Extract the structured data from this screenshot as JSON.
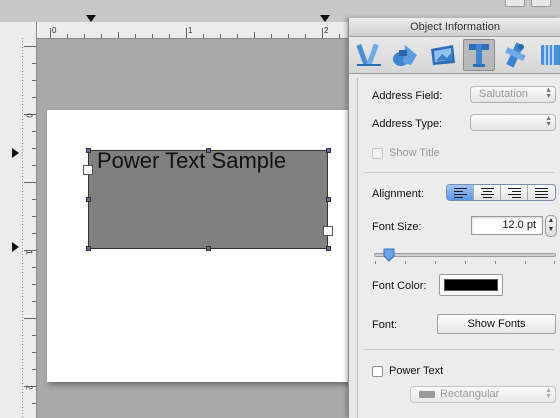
{
  "rulers": {
    "horizontal_numbers": [
      "0",
      "1",
      "2"
    ],
    "vertical_numbers": [
      "0",
      "1",
      "2"
    ]
  },
  "canvas": {
    "text_box_text": "Power Text Sample",
    "text_box_fill": "#808080"
  },
  "inspector": {
    "title": "Object Information",
    "toolbar": [
      {
        "name": "arrange-icon",
        "selected": false
      },
      {
        "name": "graphic-icon",
        "selected": false
      },
      {
        "name": "image-icon",
        "selected": false
      },
      {
        "name": "text-icon",
        "selected": true
      },
      {
        "name": "database-icon",
        "selected": false
      },
      {
        "name": "layout-icon",
        "selected": false
      }
    ],
    "address_field": {
      "label": "Address Field:",
      "value": "Salutation"
    },
    "address_type": {
      "label": "Address Type:",
      "value": ""
    },
    "show_title": {
      "label": "Show Title",
      "checked": false
    },
    "alignment": {
      "label": "Alignment:",
      "options": [
        "left",
        "center",
        "right",
        "justify"
      ],
      "selected": "left"
    },
    "font_size": {
      "label": "Font Size:",
      "value": "12.0 pt",
      "slider_fraction": 0.05
    },
    "font_color": {
      "label": "Font Color:",
      "value": "#000000"
    },
    "font": {
      "label": "Font:",
      "button_label": "Show Fonts"
    },
    "power_text": {
      "label": "Power Text",
      "checked": false,
      "shape": "Rectangular"
    }
  },
  "colors": {
    "selection_accent": "#5b97e2",
    "icon_blue": "#4a8fd6"
  }
}
